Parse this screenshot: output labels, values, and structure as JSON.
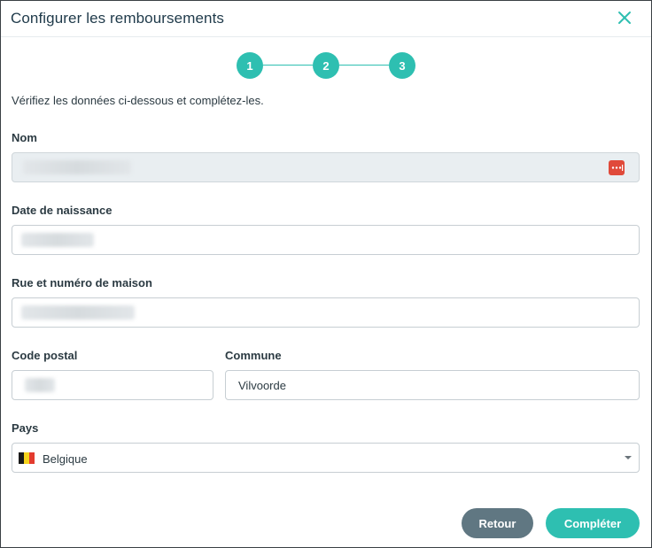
{
  "dialog": {
    "title": "Configurer les remboursements",
    "close_icon": "close-icon"
  },
  "stepper": {
    "steps": [
      "1",
      "2",
      "3"
    ],
    "accent": "#2ebfb1"
  },
  "intro": "Vérifiez les données ci-dessous et complétez-les.",
  "form": {
    "nom": {
      "label": "Nom",
      "value": "",
      "disabled": true,
      "icon": "password-manager-icon"
    },
    "date_naissance": {
      "label": "Date de naissance",
      "value": ""
    },
    "rue": {
      "label": "Rue et numéro de maison",
      "value": ""
    },
    "code_postal": {
      "label": "Code postal",
      "value": ""
    },
    "commune": {
      "label": "Commune",
      "value": "Vilvoorde"
    },
    "pays": {
      "label": "Pays",
      "value": "Belgique",
      "flag_icon": "belgium-flag-icon"
    }
  },
  "buttons": {
    "back": "Retour",
    "complete": "Compléter"
  },
  "colors": {
    "primary": "#2ebfb1",
    "secondary": "#607782",
    "title": "#1f3a4a",
    "disabled_bg": "#e9eef1"
  }
}
